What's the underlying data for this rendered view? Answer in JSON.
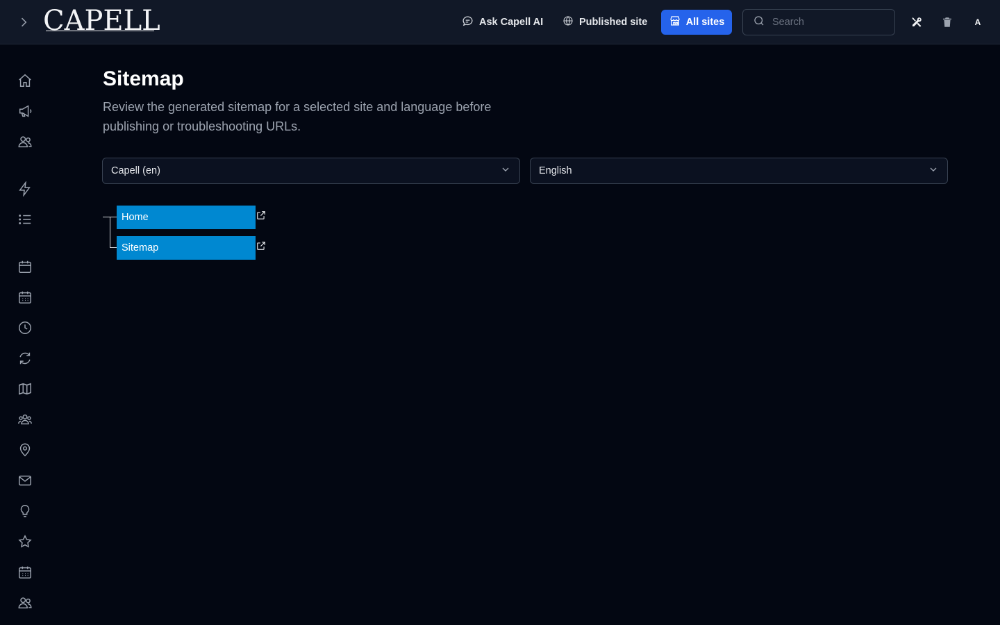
{
  "header": {
    "logo_text": "CAPELL",
    "ask_ai_label": "Ask Capell AI",
    "published_site_label": "Published site",
    "all_sites_label": "All sites",
    "search_placeholder": "Search",
    "avatar_initial": "A"
  },
  "sidebar": {
    "icons": [
      "home-icon",
      "megaphone-icon",
      "users-icon",
      "bolt-icon",
      "list-icon",
      "calendar-icon",
      "calendar-days-icon",
      "clock-icon",
      "refresh-icon",
      "map-icon",
      "user-group-icon",
      "map-pin-icon",
      "envelope-icon",
      "light-bulb-icon",
      "star-icon",
      "calendar-days-icon",
      "users-icon"
    ]
  },
  "main": {
    "title": "Sitemap",
    "description": "Review the generated sitemap for a selected site and language before publishing or troubleshooting URLs.",
    "site_select_value": "Capell (en)",
    "language_select_value": "English",
    "tree": [
      {
        "label": "Home"
      },
      {
        "label": "Sitemap"
      }
    ]
  },
  "colors": {
    "background": "#030712",
    "header_bg": "#111827",
    "accent": "#2563eb",
    "node": "#0088d1"
  }
}
